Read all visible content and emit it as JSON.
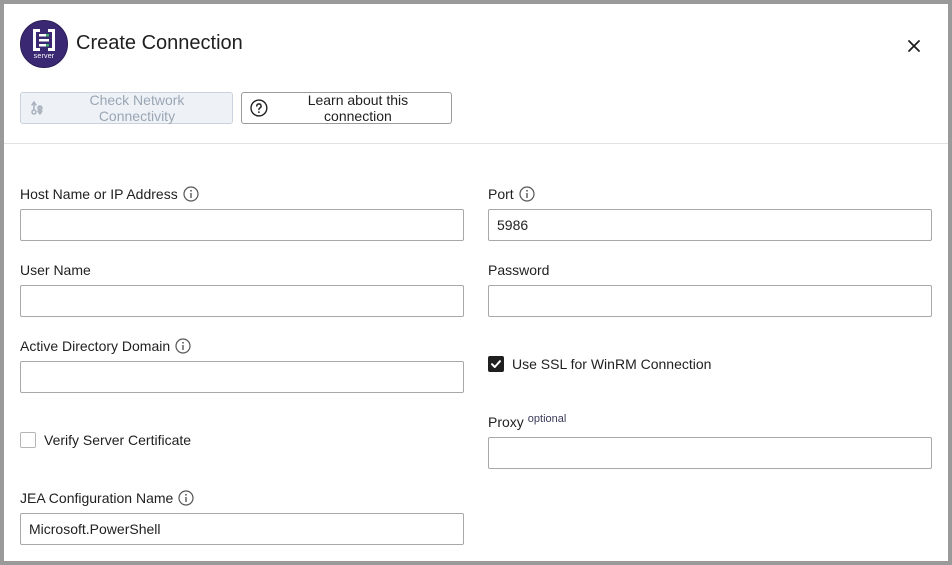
{
  "dialog": {
    "title": "Create Connection",
    "logo_text": "server",
    "colors": {
      "logo_bg": "#3b2872",
      "logo_accent": "#3fae6e"
    }
  },
  "toolbar": {
    "check_label": "Check Network Connectivity",
    "learn_label": "Learn about this connection"
  },
  "form": {
    "host": {
      "label": "Host Name or IP Address",
      "value": ""
    },
    "port": {
      "label": "Port",
      "value": "5986"
    },
    "username": {
      "label": "User Name",
      "value": ""
    },
    "password": {
      "label": "Password",
      "value": ""
    },
    "domain": {
      "label": "Active Directory Domain",
      "value": ""
    },
    "use_ssl": {
      "label": "Use SSL for WinRM Connection",
      "checked": true
    },
    "verify_cert": {
      "label": "Verify Server Certificate",
      "checked": false
    },
    "proxy": {
      "label": "Proxy",
      "optional": "optional",
      "value": ""
    },
    "jea": {
      "label": "JEA Configuration Name",
      "value": "Microsoft.PowerShell"
    }
  }
}
